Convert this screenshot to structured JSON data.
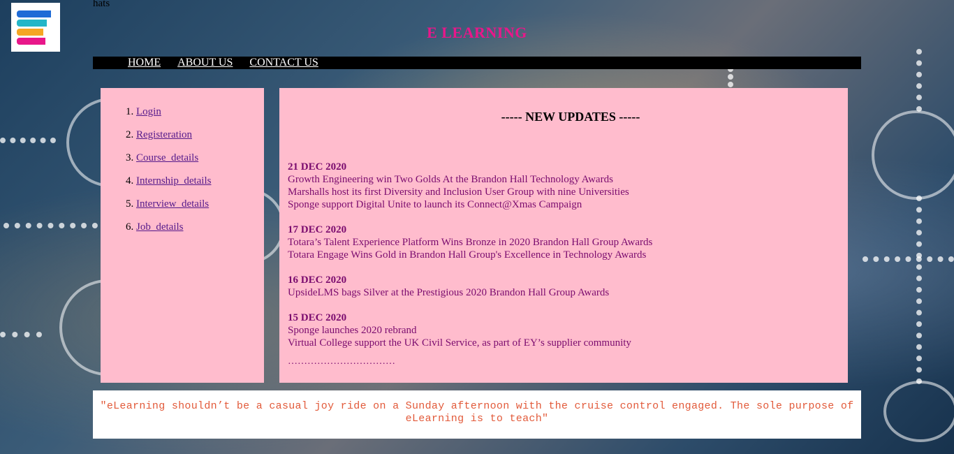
{
  "logo": {
    "name": "elearning-logo",
    "colors": [
      "#1e6bd6",
      "#24b6c8",
      "#f5a623",
      "#e8178a"
    ]
  },
  "top_text": "hats",
  "site_title": "E LEARNING",
  "nav": {
    "items": [
      {
        "label": "HOME"
      },
      {
        "label": "ABOUT US"
      },
      {
        "label": "CONTACT US"
      }
    ]
  },
  "sidebar": {
    "items": [
      {
        "label": "Login"
      },
      {
        "label": "Registeration"
      },
      {
        "label": "Course_details"
      },
      {
        "label": "Internship_details"
      },
      {
        "label": "Interview_details"
      },
      {
        "label": "Job_details"
      }
    ]
  },
  "main": {
    "title": "----- NEW UPDATES -----",
    "updates": [
      {
        "date": "21 DEC 2020",
        "lines": [
          "Growth Engineering win Two Golds At the Brandon Hall Technology Awards",
          "Marshalls host its first Diversity and Inclusion User Group with nine Universities",
          "Sponge support Digital Unite to launch its Connect@Xmas Campaign"
        ]
      },
      {
        "date": "17 DEC 2020",
        "lines": [
          "Totara’s Talent Experience Platform Wins Bronze in 2020 Brandon Hall Group Awards",
          "Totara Engage Wins Gold in Brandon Hall Group's Excellence in Technology Awards"
        ]
      },
      {
        "date": "16 DEC 2020",
        "lines": [
          "UpsideLMS bags Silver at the Prestigious 2020 Brandon Hall Group Awards"
        ]
      },
      {
        "date": "15 DEC 2020",
        "lines": [
          "Sponge launches 2020 rebrand",
          "Virtual College support the UK Civil Service, as part of EY’s supplier community"
        ]
      }
    ],
    "more": "……………………………"
  },
  "quote": "\"eLearning shouldn’t be a casual joy ride on a Sunday afternoon with the cruise control engaged. The sole purpose of eLearning is to teach\"",
  "colors": {
    "title": "#e8178a",
    "panel": "#ffbccd",
    "update_text": "#7a0b6e",
    "quote_text": "#e25a3a",
    "link": "#551a8b"
  }
}
